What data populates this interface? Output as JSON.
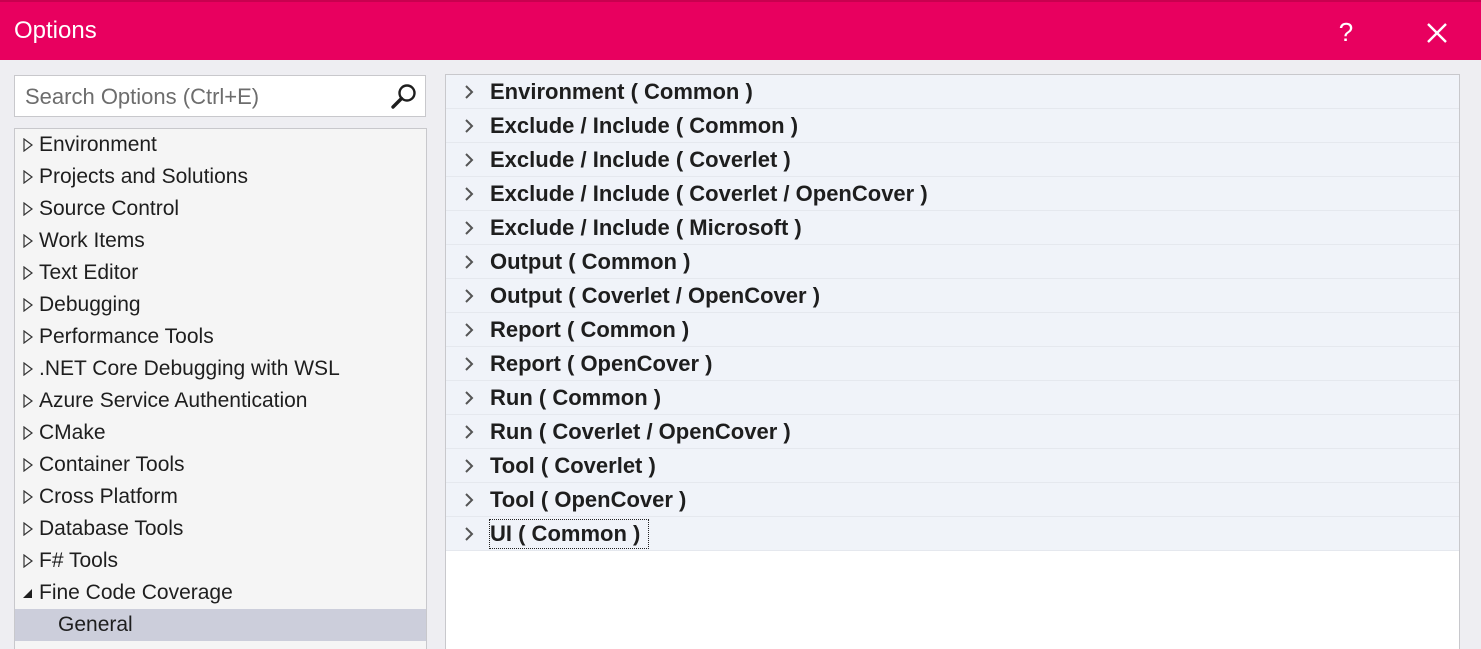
{
  "window": {
    "title": "Options",
    "help_label": "?",
    "accent_color": "#e8005f"
  },
  "search": {
    "placeholder": "Search Options (Ctrl+E)",
    "icon": "search-icon"
  },
  "tree": {
    "items": [
      {
        "label": "Environment",
        "expanded": false
      },
      {
        "label": "Projects and Solutions",
        "expanded": false
      },
      {
        "label": "Source Control",
        "expanded": false
      },
      {
        "label": "Work Items",
        "expanded": false
      },
      {
        "label": "Text Editor",
        "expanded": false
      },
      {
        "label": "Debugging",
        "expanded": false
      },
      {
        "label": "Performance Tools",
        "expanded": false
      },
      {
        "label": ".NET Core Debugging with WSL",
        "expanded": false
      },
      {
        "label": "Azure Service Authentication",
        "expanded": false
      },
      {
        "label": "CMake",
        "expanded": false
      },
      {
        "label": "Container Tools",
        "expanded": false
      },
      {
        "label": "Cross Platform",
        "expanded": false
      },
      {
        "label": "Database Tools",
        "expanded": false
      },
      {
        "label": "F# Tools",
        "expanded": false
      },
      {
        "label": "Fine Code Coverage",
        "expanded": true
      }
    ],
    "selected_child": {
      "label": "General"
    }
  },
  "categories": [
    "Environment ( Common )",
    "Exclude / Include ( Common )",
    "Exclude / Include ( Coverlet )",
    "Exclude / Include ( Coverlet / OpenCover )",
    "Exclude / Include ( Microsoft )",
    "Output ( Common )",
    "Output ( Coverlet / OpenCover )",
    "Report ( Common )",
    "Report ( OpenCover )",
    "Run ( Common )",
    "Run ( Coverlet / OpenCover )",
    "Tool ( Coverlet )",
    "Tool ( OpenCover )",
    "UI ( Common )"
  ]
}
